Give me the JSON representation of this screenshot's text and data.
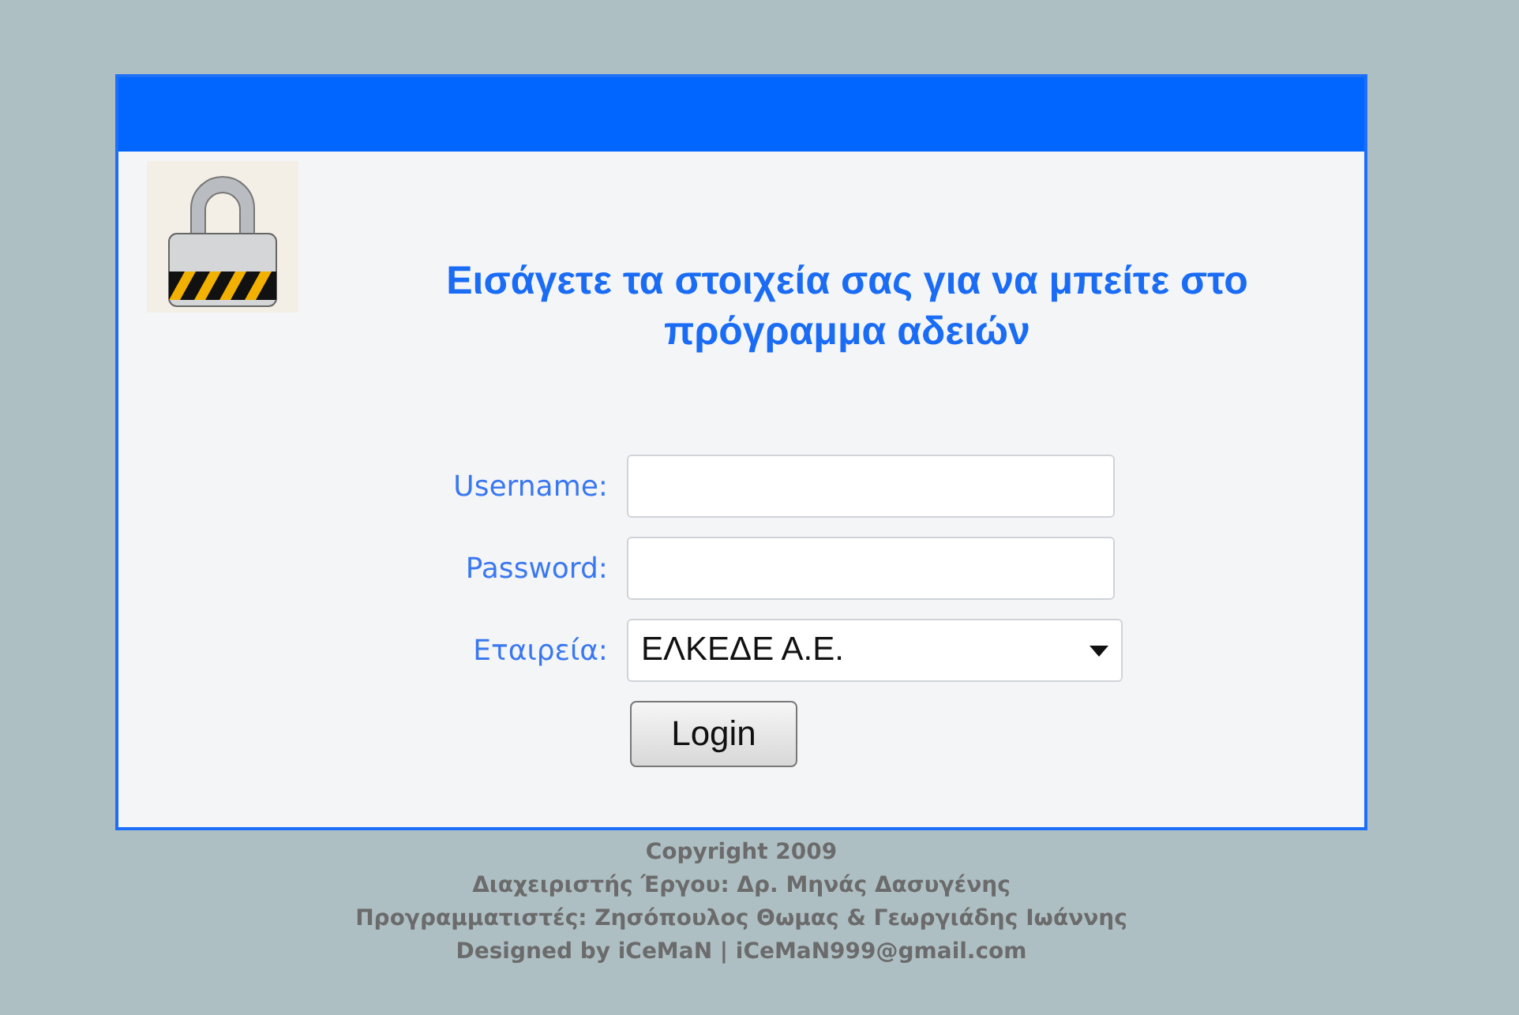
{
  "heading": [
    "Εισάγετε τα στοιχεία σας για να μπείτε στο",
    "πρόγραμμα αδειών"
  ],
  "form": {
    "fields": [
      {
        "kind": "text",
        "label": "Username:"
      },
      {
        "kind": "password",
        "label": "Password:"
      },
      {
        "kind": "select",
        "label": "Εταιρεία:",
        "value": "ΕΛΚΕΔΕ Α.Ε."
      }
    ],
    "button": "Login"
  },
  "footer": [
    "Copyright 2009",
    "Διαχειριστής Έργου: Δρ. Μηνάς Δασυγένης",
    "Προγραμματιστές: Ζησόπουλος Θωμας & Γεωργιάδης Ιωάννης",
    "Designed by iCeMaN | iCeMaN999@gmail.com"
  ]
}
